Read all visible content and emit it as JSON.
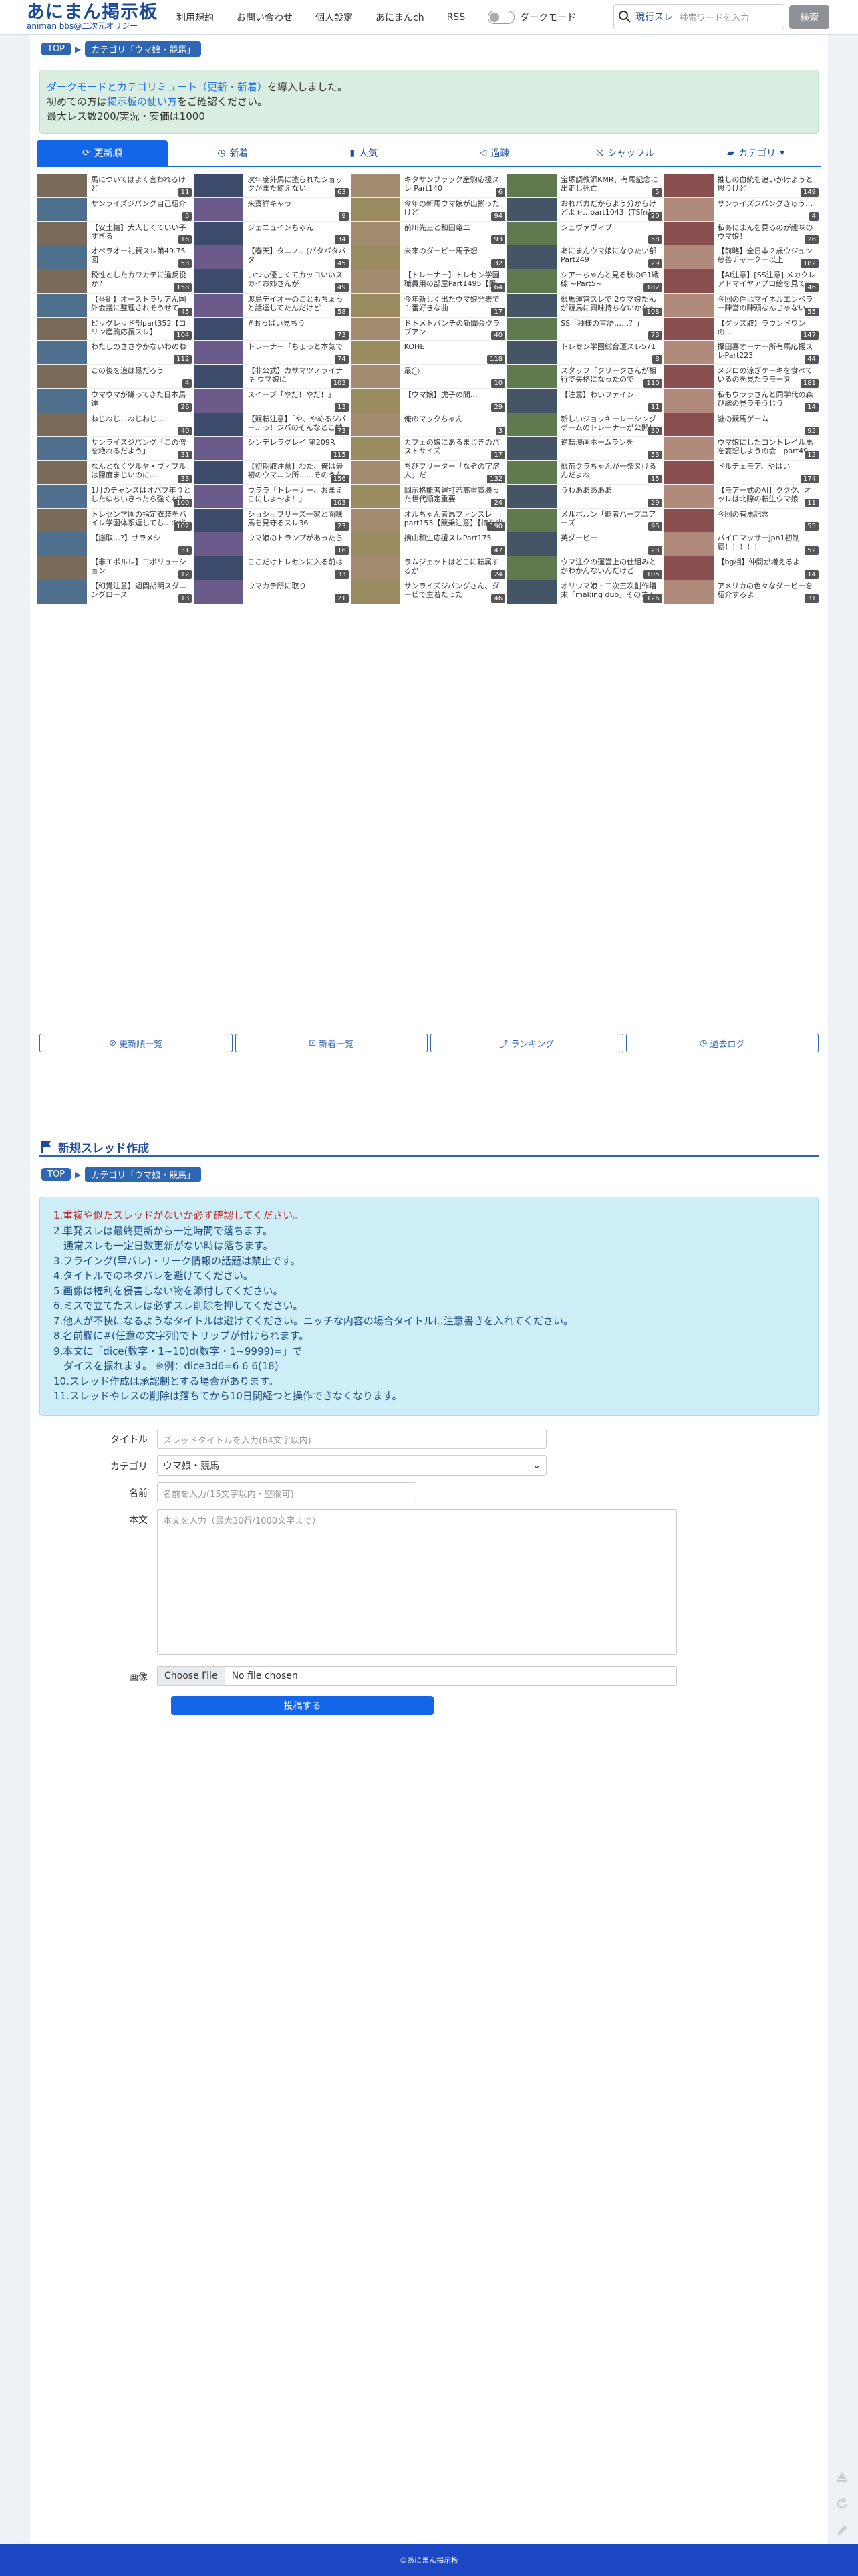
{
  "header": {
    "logo_title": "あにまん掲示板",
    "logo_sub": "animan bbs@二次元オリジー",
    "nav": [
      "利用規約",
      "お問い合わせ",
      "個人設定",
      "あにまんch",
      "RSS"
    ],
    "dark_mode_label": "ダークモード",
    "search_current": "現行スレ",
    "search_placeholder": "検索ワードを入力",
    "search_button": "検索"
  },
  "breadcrumb": {
    "top": "TOP",
    "category": "カテゴリ「ウマ娘・競馬」"
  },
  "notice": {
    "line1_link": "ダークモードとカテゴリミュート（更新・新着）",
    "line1_rest": "を導入しました。",
    "line2_pre": "初めての方は",
    "line2_link": "掲示板の使い方",
    "line2_post": "をご確認ください。",
    "line3": "最大レス数200/実況・安価は1000"
  },
  "tabs": [
    "更新順",
    "新着",
    "人気",
    "過疎",
    "シャッフル",
    "カテゴリ"
  ],
  "threads": [
    {
      "t": "馬についてはよく言われるけど",
      "n": "11"
    },
    {
      "t": "次年度外馬に塗られたショックがまた癒えない",
      "n": "63"
    },
    {
      "t": "キタサンブラック産駒応援スレ Part140",
      "n": "6"
    },
    {
      "t": "宝塚調教師KMR、有馬記念に出走し死亡",
      "n": "5"
    },
    {
      "t": "推しの血統を追いかけようと思うけど",
      "n": "149"
    },
    {
      "t": "サンライズジパング自己紹介",
      "n": "5"
    },
    {
      "t": "来賓詳キャラ",
      "n": "9"
    },
    {
      "t": "今年の新馬ウマ娘が出揃ったけど",
      "n": "94"
    },
    {
      "t": "おれバカだからよう分からけどよぉ…part1043【TSfn】",
      "n": "20"
    },
    {
      "t": "サンライズジパングきゅう…",
      "n": "4"
    },
    {
      "t": "【安土輪】大人しくていい子すぎる",
      "n": "16"
    },
    {
      "t": "ジェニュインちゃん",
      "n": "34"
    },
    {
      "t": "前川先三と和田竜二",
      "n": "93"
    },
    {
      "t": "シュヴァヴィブ",
      "n": "58"
    },
    {
      "t": "私あにまんを見るのが趣味のウマ娘！",
      "n": "26"
    },
    {
      "t": "オペラオー礼賛スレ第49.75回",
      "n": "53"
    },
    {
      "t": "【春天】タニノ…(バタバタバタ",
      "n": "45"
    },
    {
      "t": "未来のダービー馬予想",
      "n": "32"
    },
    {
      "t": "あにまんウマ娘になりたい部Part249",
      "n": "29"
    },
    {
      "t": "【前略】全日本２歳ウジュン慈善チャーク一以上",
      "n": "182"
    },
    {
      "t": "税性としたカワカテに違反役か？",
      "n": "158"
    },
    {
      "t": "いつも優しくてカッコいいスカイお姉さんが",
      "n": "49"
    },
    {
      "t": "【トレーナー】トレセン学園職員用の部屋Part1495【懇談】",
      "n": "64"
    },
    {
      "t": "シアーちゃんと見る秋のG1戦線 ~Part5~",
      "n": "182"
    },
    {
      "t": "【AI注意】[SS注意] メカクレアドマイヤアプロ絵を見ていいのでおにはみんなの好きにして PL12",
      "n": "46"
    },
    {
      "t": "【番組】オーストラリアん国外会議に整理されそうせて…",
      "n": "45"
    },
    {
      "t": "渡島デイオーのこともちょっと話達してたんだけど",
      "n": "58"
    },
    {
      "t": "今年新しく出たウマ娘発表で１番好きな曲",
      "n": "17"
    },
    {
      "t": "競馬運営スレで 2ウマ娘たんが競馬に興味持ちないかな〜",
      "n": "108"
    },
    {
      "t": "今回の件はマイネルエンペラー陣営の陣頭なんじゃないか？",
      "n": "55"
    },
    {
      "t": "ピッグレッド部part352【コリン産駒応援スレ】",
      "n": "104"
    },
    {
      "t": "#おっぱい見ちう",
      "n": "73"
    },
    {
      "t": "ドトメトパンチの新聞会クラブアン",
      "n": "40"
    },
    {
      "t": "SS「種様の言語……？」",
      "n": "73"
    },
    {
      "t": "【グッズ取】ラウンドワンの…",
      "n": "147"
    },
    {
      "t": "わたしのささやかないわのね",
      "n": "112"
    },
    {
      "t": "トレーナー「ちょっと本気で",
      "n": "74"
    },
    {
      "t": "KOHE",
      "n": "118"
    },
    {
      "t": "トレセン学園総合運スレ571",
      "n": "8"
    },
    {
      "t": "攝田喜オーナー所有馬応援スレPart223",
      "n": "44"
    },
    {
      "t": "この後を追は最だろう",
      "n": "4"
    },
    {
      "t": "【非公式】カサマツノライナキ ウマ娘に",
      "n": "103"
    },
    {
      "t": "最◯",
      "n": "10"
    },
    {
      "t": "スタッフ「クリークさんが相行で失格になったので",
      "n": "110"
    },
    {
      "t": "メジロの涼ぎケーキを食べているのを見たラモーヌ",
      "n": "181"
    },
    {
      "t": "ウマウマが嫌ってきた日本馬達",
      "n": "26"
    },
    {
      "t": "スイープ「やだ！やだ！」",
      "n": "13"
    },
    {
      "t": "【ウマ娘】虎子の間…",
      "n": "29"
    },
    {
      "t": "【注意】わいファイン",
      "n": "11"
    },
    {
      "t": "私もウララさんと同学代の森び総の見ラモうじう",
      "n": "14"
    },
    {
      "t": "ねじねじ…ねじねじ…",
      "n": "40"
    },
    {
      "t": "【競転注意】「や、やめるジパー…っ！ジパのそんなとこ触っても何もんん…っ」？!?",
      "n": "73"
    },
    {
      "t": "俺のマックちゃん",
      "n": "3"
    },
    {
      "t": "新しいジョッキーレーシングゲームのトレーナーが公開！",
      "n": "30"
    },
    {
      "t": "謎の競馬ゲーム",
      "n": "92"
    },
    {
      "t": "サンライズジパング「この僧を絶れるだよう」",
      "n": "31"
    },
    {
      "t": "シンデレラグレイ 第209R",
      "n": "115"
    },
    {
      "t": "カフェの娘にあるまじきのパストサイズ",
      "n": "17"
    },
    {
      "t": "逆転漫画ホームランを",
      "n": "53"
    },
    {
      "t": "ウマ娘にしたコントレイル馬を妄想しようの会　part49",
      "n": "12"
    },
    {
      "t": "なんとなくツルヤ・ヴィブルは隠度まじいのに…",
      "n": "33"
    },
    {
      "t": "【初期取注意】わた、俺は最初のウマニン所……そのうち",
      "n": "156"
    },
    {
      "t": "ちびフリーター「なぞの字溶人」だ！",
      "n": "132"
    },
    {
      "t": "競苗クラちゃんが一条ヌけるんだよね",
      "n": "15"
    },
    {
      "t": "ドルチェモア、やはい",
      "n": "174"
    },
    {
      "t": "1月のチャンスはオバフ年りとしたゆちいきったら強くね？サガラ行のあったっけ",
      "n": "100"
    },
    {
      "t": "ウララ「トレーナー、おまえこにしよ〜よ！」",
      "n": "103"
    },
    {
      "t": "岡示格能者遅打若高重賞勝った世代順定重要",
      "n": "24"
    },
    {
      "t": "うわあああああ",
      "n": "29"
    },
    {
      "t": "【モア一式のAI】ククク、オッレは北際の転生ウマ娘",
      "n": "11"
    },
    {
      "t": "トレセン学園の指定衣装をバイレ学園体系返しても…の総作活属？",
      "n": "102"
    },
    {
      "t": "ショショブリーズ一家と面味馬を見守るスレ36",
      "n": "23"
    },
    {
      "t": "オルちゃん者馬ファンスレ part153【競乗注意】【持ち出し可】",
      "n": "190"
    },
    {
      "t": "メルボルン「覇者ハープユアーズ",
      "n": "95"
    },
    {
      "t": "今回の有馬記念",
      "n": "55"
    },
    {
      "t": "【謎取…?】サラメシ",
      "n": "31"
    },
    {
      "t": "ウマ娘のトランプがあったら",
      "n": "16"
    },
    {
      "t": "摘山和生応援スレPart175",
      "n": "47"
    },
    {
      "t": "英ダービー",
      "n": "23"
    },
    {
      "t": "バイロマッサーjpn1初制覇！！！！！",
      "n": "52"
    },
    {
      "t": "【非エボルレ】エボリューション",
      "n": "12"
    },
    {
      "t": "ここだけトレセンに入る前は",
      "n": "33"
    },
    {
      "t": "ラムジェットはどこに転属するか",
      "n": "24"
    },
    {
      "t": "ウマ注クの運営上の仕組みとかわかんないんだけど",
      "n": "105"
    },
    {
      "t": "【bg相】仲間が増えるよ",
      "n": "14"
    },
    {
      "t": "【幻覚注意】週間胡明スダニングロース",
      "n": "13"
    },
    {
      "t": "ウマカテ所に取り",
      "n": "21"
    },
    {
      "t": "サンライズジパングさん、ダービで主着たった",
      "n": "46"
    },
    {
      "t": "オリウマ娘・二次三次創作増末「making duo」そのさんじゅうさろう",
      "n": "126"
    },
    {
      "t": "アメリカの色々なダービーを紹介するよ",
      "n": "31"
    }
  ],
  "list_buttons": [
    "更新順一覧",
    "新着一覧",
    "ランキング",
    "過去ログ"
  ],
  "new_thread": {
    "title": "新規スレッド作成",
    "rules": [
      "1.重複や似たスレッドがないか必ず確認してください。",
      "2.単発スレは最終更新から一定時間で落ちます。",
      "　通常スレも一定日数更新がない時は落ちます。",
      "3.フライング(早バレ)・リーク情報の話題は禁止です。",
      "4.タイトルでのネタバレを避けてください。",
      "5.画像は権利を侵害しない物を添付してください。",
      "6.ミスで立てたスレは必ずスレ削除を押してください。",
      "7.他人が不快になるようなタイトルは避けてください。ニッチな内容の場合タイトルに注意書きを入れてください。",
      "8.名前欄に#(任意の文字列)でトリップが付けられます。",
      "9.本文に「dice(数字・1~10)d(数字・1~9999)=」で",
      "　ダイスを振れます。 ※例：dice3d6=6 6 6(18)",
      "10.スレッド作成は承認制とする場合があります。",
      "11.スレッドやレスの削除は落ちてから10日間経つと操作できなくなります。"
    ],
    "label_title": "タイトル",
    "ph_title": "スレッドタイトルを入力(64文字以内)",
    "label_category": "カテゴリ",
    "category_value": "ウマ娘・競馬",
    "label_name": "名前",
    "ph_name": "名前を入力(15文字以内・空欄可)",
    "label_body": "本文",
    "ph_body": "本文を入力（最大30行/1000文字まで）",
    "label_image": "画像",
    "file_button": "Choose File",
    "file_none": "No file chosen",
    "submit": "投稿する"
  },
  "footer": "©あにまん掲示板",
  "colors": {
    "accent": "#1366e8",
    "brand": "#1b4a96",
    "footer": "#1b47c4",
    "notice_bg": "#d9eee1",
    "rules_bg": "#cdeef6"
  }
}
